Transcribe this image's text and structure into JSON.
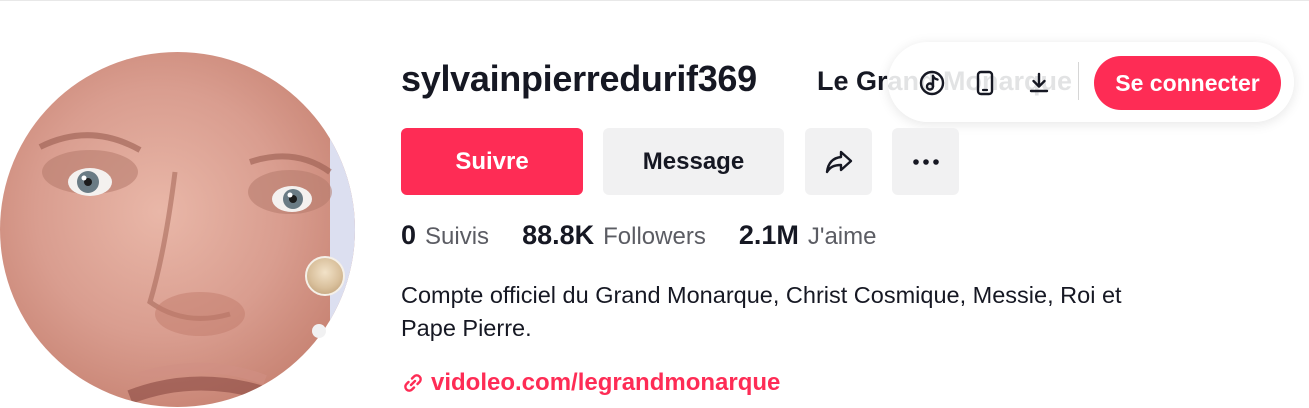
{
  "profile": {
    "username": "sylvainpierredurif369",
    "nickname": "Le Grand Monarque",
    "bio": "Compte officiel du Grand Monarque, Christ Cosmique, Messie, Roi et\nPape Pierre.",
    "link": "vidoleo.com/legrandmonarque"
  },
  "actions": {
    "follow_label": "Suivre",
    "message_label": "Message",
    "share_icon": "share-icon",
    "more_icon": "more-icon"
  },
  "stats": [
    {
      "value": "0",
      "label": "Suivis"
    },
    {
      "value": "88.8K",
      "label": "Followers"
    },
    {
      "value": "2.1M",
      "label": "J'aime"
    }
  ],
  "topbar": {
    "icons": [
      "tiktok-icon",
      "mobile-icon",
      "download-icon"
    ],
    "login_label": "Se connecter"
  },
  "colors": {
    "accent": "#fe2c55",
    "secondary_bg": "#f1f1f2",
    "text": "#161823",
    "muted_text": "#5b5c63"
  }
}
